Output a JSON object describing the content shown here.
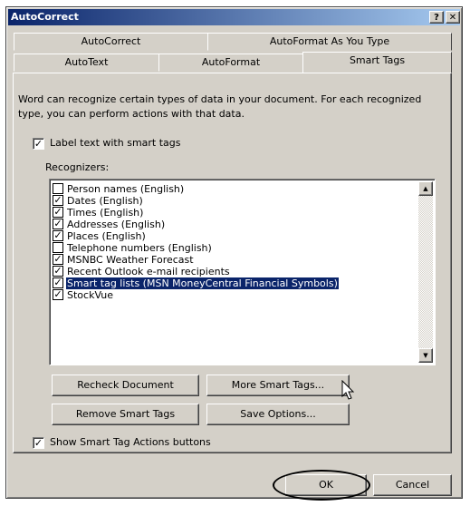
{
  "window": {
    "title": "AutoCorrect"
  },
  "titlebar": {
    "help_label": "?",
    "close_label": "✕"
  },
  "tabs": {
    "row1": [
      {
        "label": "AutoCorrect"
      },
      {
        "label": "AutoFormat As You Type"
      }
    ],
    "row2": [
      {
        "label": "AutoText"
      },
      {
        "label": "AutoFormat"
      },
      {
        "label": "Smart Tags",
        "active": true
      }
    ]
  },
  "smart_tags": {
    "description": "Word can recognize certain types of data in your document. For each recognized type, you can perform actions with that data.",
    "label_option": {
      "label": "Label text with smart tags",
      "checked": true
    },
    "recognizers_label": "Recognizers:",
    "recognizers": [
      {
        "label": "Person names (English)",
        "checked": false
      },
      {
        "label": "Dates (English)",
        "checked": true
      },
      {
        "label": "Times (English)",
        "checked": true
      },
      {
        "label": "Addresses (English)",
        "checked": true
      },
      {
        "label": "Places (English)",
        "checked": true
      },
      {
        "label": "Telephone numbers (English)",
        "checked": false
      },
      {
        "label": "MSNBC Weather Forecast",
        "checked": true
      },
      {
        "label": "Recent Outlook e-mail recipients",
        "checked": true
      },
      {
        "label": "Smart tag lists (MSN MoneyCentral Financial Symbols)",
        "checked": true,
        "selected": true
      },
      {
        "label": "StockVue",
        "checked": true
      }
    ],
    "buttons": {
      "recheck": "Recheck Document",
      "more": "More Smart Tags...",
      "remove": "Remove Smart Tags",
      "save": "Save Options..."
    },
    "show_actions": {
      "label": "Show Smart Tag Actions buttons",
      "checked": true
    }
  },
  "footer": {
    "ok_label": "OK",
    "cancel_label": "Cancel"
  },
  "scrollbar": {
    "up_glyph": "▲",
    "down_glyph": "▼"
  },
  "checkmark_glyph": "✓",
  "colors": {
    "title_start": "#0a246a",
    "title_end": "#a6caf0",
    "selection": "#0a246a",
    "face": "#d4d0c8"
  }
}
